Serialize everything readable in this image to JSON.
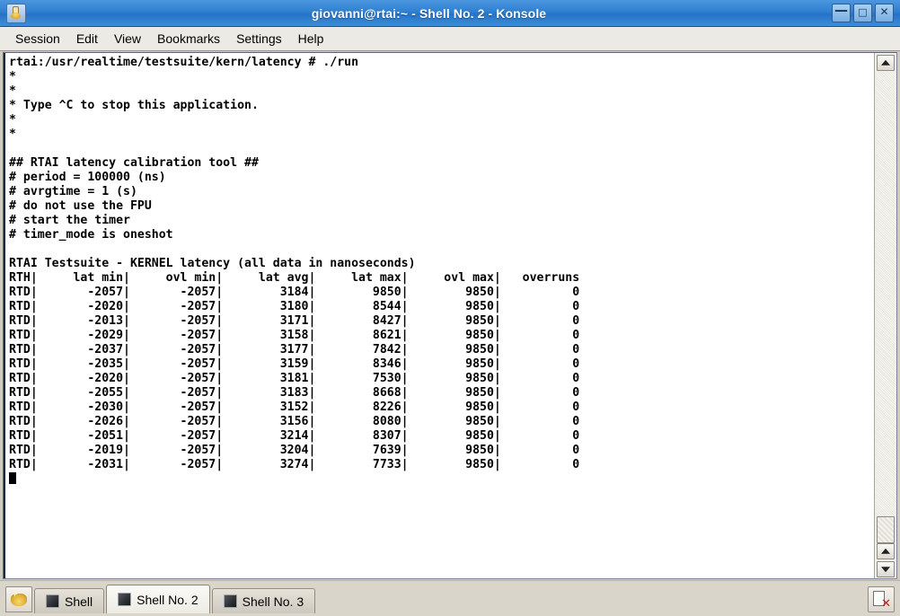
{
  "window": {
    "title": "giovanni@rtai:~ - Shell No. 2 - Konsole",
    "icon": "konsole-icon",
    "controls": [
      {
        "name": "minimize-button",
        "glyph": "—"
      },
      {
        "name": "maximize-button",
        "glyph": "□"
      },
      {
        "name": "close-button",
        "glyph": "✕"
      }
    ]
  },
  "menubar": {
    "items": [
      {
        "label": "Session"
      },
      {
        "label": "Edit"
      },
      {
        "label": "View"
      },
      {
        "label": "Bookmarks"
      },
      {
        "label": "Settings"
      },
      {
        "label": "Help"
      }
    ]
  },
  "terminal": {
    "prompt_line": "rtai:/usr/realtime/testsuite/kern/latency # ./run",
    "banner": [
      "*",
      "*",
      "* Type ^C to stop this application.",
      "*",
      "*",
      "",
      "## RTAI latency calibration tool ##",
      "# period = 100000 (ns)",
      "# avrgtime = 1 (s)",
      "# do not use the FPU",
      "# start the timer",
      "# timer_mode is oneshot",
      "",
      "RTAI Testsuite - KERNEL latency (all data in nanoseconds)"
    ],
    "table_header": "RTH|     lat min|     ovl min|     lat avg|     lat max|     ovl max|   overruns",
    "table_rows": [
      "RTD|       -2057|       -2057|        3184|        9850|        9850|          0",
      "RTD|       -2020|       -2057|        3180|        8544|        9850|          0",
      "RTD|       -2013|       -2057|        3171|        8427|        9850|          0",
      "RTD|       -2029|       -2057|        3158|        8621|        9850|          0",
      "RTD|       -2037|       -2057|        3177|        7842|        9850|          0",
      "RTD|       -2035|       -2057|        3159|        8346|        9850|          0",
      "RTD|       -2020|       -2057|        3181|        7530|        9850|          0",
      "RTD|       -2055|       -2057|        3183|        8668|        9850|          0",
      "RTD|       -2030|       -2057|        3152|        8226|        9850|          0",
      "RTD|       -2026|       -2057|        3156|        8080|        9850|          0",
      "RTD|       -2051|       -2057|        3214|        8307|        9850|          0",
      "RTD|       -2019|       -2057|        3204|        7639|        9850|          0",
      "RTD|       -2031|       -2057|        3274|        7733|        9850|          0"
    ],
    "columns": [
      "RTH",
      "lat min",
      "ovl min",
      "lat avg",
      "lat max",
      "ovl max",
      "overruns"
    ],
    "colors": {
      "background": "#ffffff",
      "foreground": "#000000"
    }
  },
  "scrollbar": {
    "top_button": "scroll-up-arrow",
    "bottom_buttons": [
      "scroll-up-arrow",
      "scroll-down-arrow"
    ]
  },
  "tabbar": {
    "new_session_label": "",
    "tabs": [
      {
        "label": "Shell",
        "active": false
      },
      {
        "label": "Shell No. 2",
        "active": true
      },
      {
        "label": "Shell No. 3",
        "active": false
      }
    ],
    "close_label": ""
  }
}
